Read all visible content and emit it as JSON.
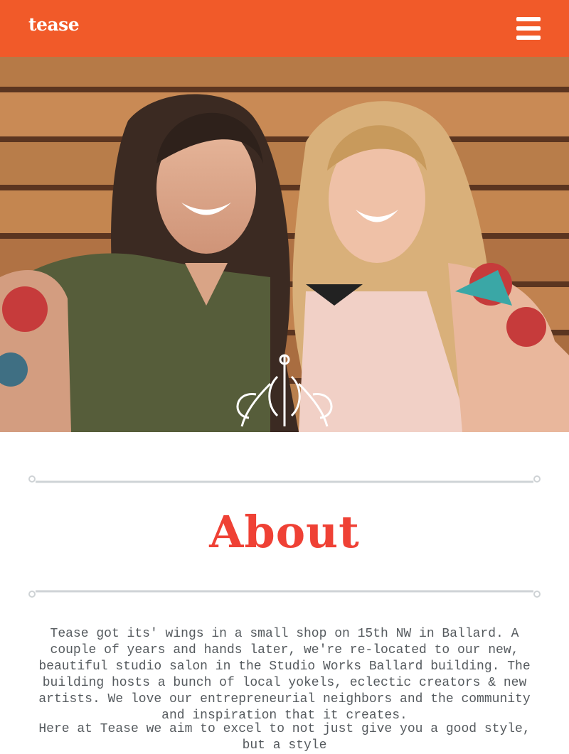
{
  "header": {
    "logo": "tease",
    "menu_icon": "hamburger-menu-icon",
    "background_color": "#f15a29"
  },
  "hero": {
    "image": "photo of two smiling stylists in front of a wooden fence",
    "ornament_icon": "flourish-ornament-icon"
  },
  "about": {
    "title": "About",
    "title_color": "#ef4135",
    "paragraph_1": "Tease got its' wings in a small shop on 15th NW in Ballard. A couple of years and hands later, we're re-located to our new, beautiful studio salon in the Studio Works Ballard building. The building hosts a bunch of local yokels, eclectic creators & new artists. We love our entrepreneurial neighbors and the community and inspiration that it creates.",
    "paragraph_2": "Here at Tease we aim to excel to not just give you a good style, but a style"
  }
}
